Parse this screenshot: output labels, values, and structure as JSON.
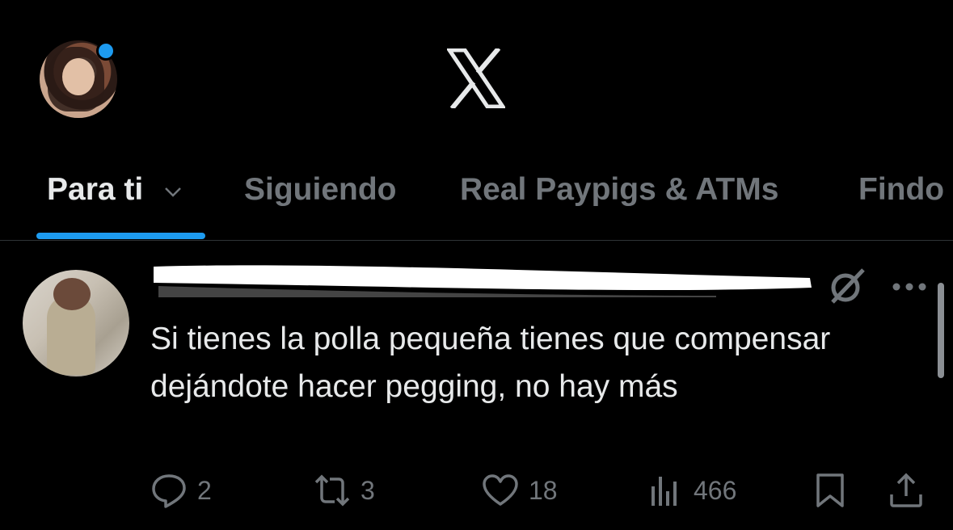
{
  "header": {
    "logo_icon": "x-logo-icon"
  },
  "tabs": [
    {
      "label": "Para ti",
      "active": true
    },
    {
      "label": "Siguiendo",
      "active": false
    },
    {
      "label": "Real Paypigs & ATMs",
      "active": false
    },
    {
      "label": "Findo",
      "active": false
    }
  ],
  "post": {
    "text": "Si tienes la polla pequeña tienes que compensar dejándote hacer pegging, no hay más",
    "actions": {
      "replies": "2",
      "reposts": "3",
      "likes": "18",
      "views": "466"
    }
  },
  "colors": {
    "accent": "#1d9bf0",
    "text": "#e7e9ea",
    "muted": "#71767b",
    "background": "#000000"
  }
}
